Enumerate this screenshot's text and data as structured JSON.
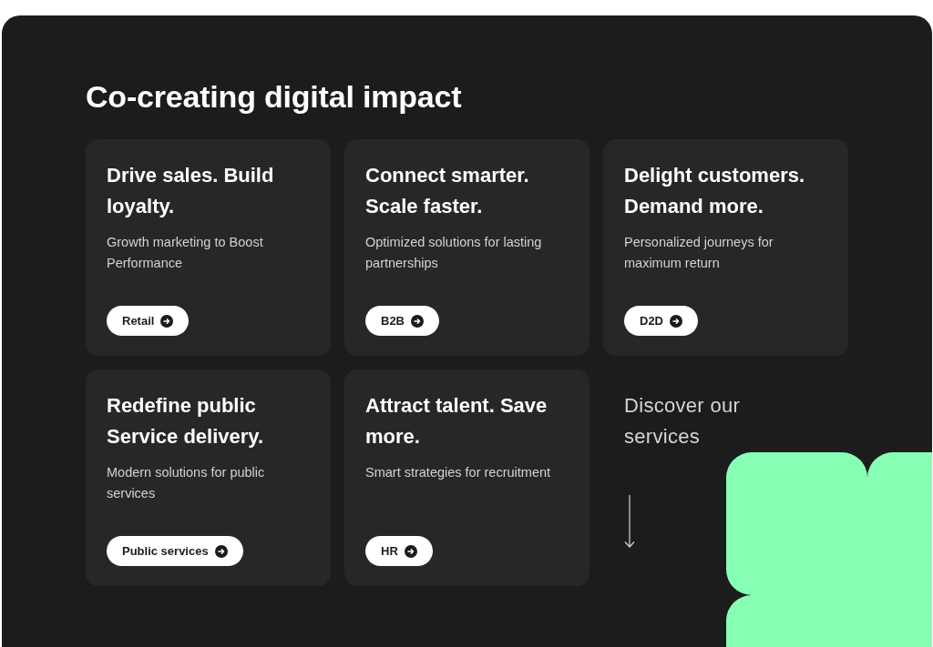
{
  "heading": "Co-creating digital impact",
  "cards": [
    {
      "title": "Drive sales. Build loyalty.",
      "description": "Growth marketing to Boost Performance",
      "button": "Retail"
    },
    {
      "title": "Connect smarter. Scale faster.",
      "description": "Optimized solutions for lasting partnerships",
      "button": "B2B"
    },
    {
      "title": "Delight customers. Demand more.",
      "description": "Personalized journeys for maximum return",
      "button": "D2D"
    },
    {
      "title": "Redefine public Service delivery.",
      "description": "Modern solutions for public services",
      "button": "Public services"
    },
    {
      "title": "Attract talent. Save more.",
      "description": "Smart strategies for recruitment",
      "button": "HR"
    }
  ],
  "discover": {
    "text": "Discover our services"
  }
}
